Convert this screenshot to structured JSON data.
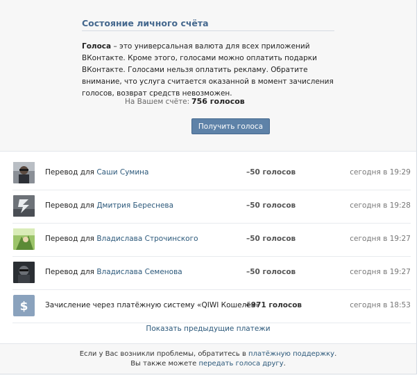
{
  "account": {
    "title": "Состояние личного счёта",
    "desc_bold": "Голоса",
    "desc_rest": " – это универсальная валюта для всех приложений ВКонтакте. Кроме этого, голосами можно оплатить подарки ВКонтакте. Голосами нельзя оплатить рекламу. Обратите внимание, что услуга считается оказанной в момент зачисления голосов, возврат средств невозможен.",
    "balance_label": "На Вашем счёте:",
    "balance_value": "756 голосов",
    "get_votes_label": "Получить голоса"
  },
  "payments": [
    {
      "prefix": "Перевод для ",
      "name": "Саши Сумина",
      "amount": "–50 голосов",
      "time": "сегодня в 19:29",
      "avatar": "user-photo"
    },
    {
      "prefix": "Перевод для ",
      "name": "Дмитрия Береснева",
      "amount": "–50 голосов",
      "time": "сегодня в 19:28",
      "avatar": "user-photo"
    },
    {
      "prefix": "Перевод для ",
      "name": "Владислава Строчинского",
      "amount": "–50 голосов",
      "time": "сегодня в 19:27",
      "avatar": "user-photo"
    },
    {
      "prefix": "Перевод для ",
      "name": "Владислава Семенова",
      "amount": "–50 голосов",
      "time": "сегодня в 19:27",
      "avatar": "user-photo"
    },
    {
      "text": "Зачисление через платёжную систему «QIWI Кошелёк»",
      "amount": "+971 голосов",
      "time": "сегодня в 18:53",
      "avatar": "dollar-icon"
    }
  ],
  "show_previous": "Показать предыдущие платежи",
  "footer": {
    "line1_pre": "Если у Вас возникли проблемы, обратитесь в ",
    "line1_link": "платёжную поддержку",
    "line1_post": ".",
    "line2_pre": "Вы также можете ",
    "line2_link": "передать голоса другу",
    "line2_post": "."
  },
  "colors": {
    "link": "#2b587a",
    "title": "#45688e",
    "button": "#5e82a8",
    "panel_bg": "#f7f7f7"
  }
}
